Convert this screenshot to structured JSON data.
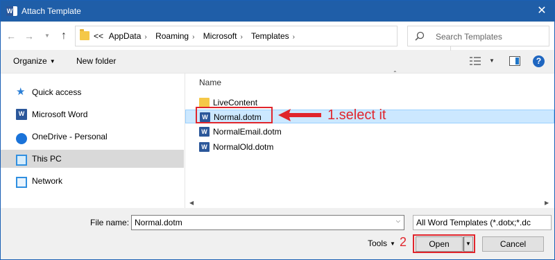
{
  "window": {
    "title": "Attach Template",
    "close_glyph": "✕"
  },
  "nav": {
    "back_glyph": "←",
    "forward_glyph": "→",
    "recent_glyph": "⌄",
    "up_glyph": "↑",
    "path_prefix": "<<",
    "breadcrumbs": [
      "AppData",
      "Roaming",
      "Microsoft",
      "Templates"
    ],
    "refresh_glyph": "↻",
    "search_placeholder": "Search Templates"
  },
  "toolbar": {
    "organize_label": "Organize",
    "new_folder_label": "New folder",
    "help_label": "?"
  },
  "sidebar": {
    "items": [
      {
        "label": "Quick access",
        "icon": "star-icon",
        "selected": false
      },
      {
        "label": "Microsoft Word",
        "icon": "word-icon",
        "selected": false
      },
      {
        "label": "OneDrive - Personal",
        "icon": "cloud-icon",
        "selected": false
      },
      {
        "label": "This PC",
        "icon": "computer-icon",
        "selected": true
      },
      {
        "label": "Network",
        "icon": "network-icon",
        "selected": false
      }
    ]
  },
  "files": {
    "column_header": "Name",
    "items": [
      {
        "name": "LiveContent",
        "type": "folder"
      },
      {
        "name": "Normal.dotm",
        "type": "word-template",
        "selected": true
      },
      {
        "name": "NormalEmail.dotm",
        "type": "word-template"
      },
      {
        "name": "NormalOld.dotm",
        "type": "word-template"
      }
    ]
  },
  "annotations": {
    "step1": "1.select it",
    "step2": "2"
  },
  "bottom": {
    "file_name_label": "File name:",
    "file_name_value": "Normal.dotm",
    "file_type": "All Word Templates (*.dotx;*.dc",
    "tools_label": "Tools",
    "open_label": "Open",
    "cancel_label": "Cancel"
  },
  "colors": {
    "title_bar": "#1f5ea8",
    "selection": "#cce8ff",
    "annotation_red": "#e0252c"
  }
}
